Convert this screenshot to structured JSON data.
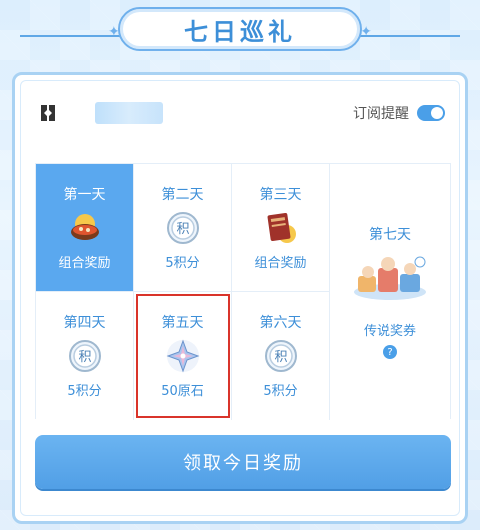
{
  "title": "七日巡礼",
  "header": {
    "subscribe_label": "订阅提醒",
    "subscribe_on": true
  },
  "days": [
    {
      "day": "第一天",
      "reward": "组合奖励",
      "icon": "food-bowl-icon",
      "state": "active"
    },
    {
      "day": "第二天",
      "reward": "5积分",
      "icon": "points-coin-icon",
      "state": "normal"
    },
    {
      "day": "第三天",
      "reward": "组合奖励",
      "icon": "book-bundle-icon",
      "state": "normal"
    },
    {
      "day": "第四天",
      "reward": "5积分",
      "icon": "points-coin-icon",
      "state": "normal"
    },
    {
      "day": "第五天",
      "reward": "50原石",
      "icon": "primogem-icon",
      "state": "highlighted"
    },
    {
      "day": "第六天",
      "reward": "5积分",
      "icon": "points-coin-icon",
      "state": "normal"
    },
    {
      "day": "第七天",
      "reward": "传说奖券",
      "icon": "legend-ticket-icon",
      "state": "normal",
      "help": "?"
    }
  ],
  "coin_glyph": "积",
  "claim_button": "领取今日奖励",
  "colors": {
    "accent": "#4a9fe8",
    "active_cell": "#5aa8ef",
    "highlight_border": "#d9342b",
    "text_blue": "#3d8fd8"
  }
}
